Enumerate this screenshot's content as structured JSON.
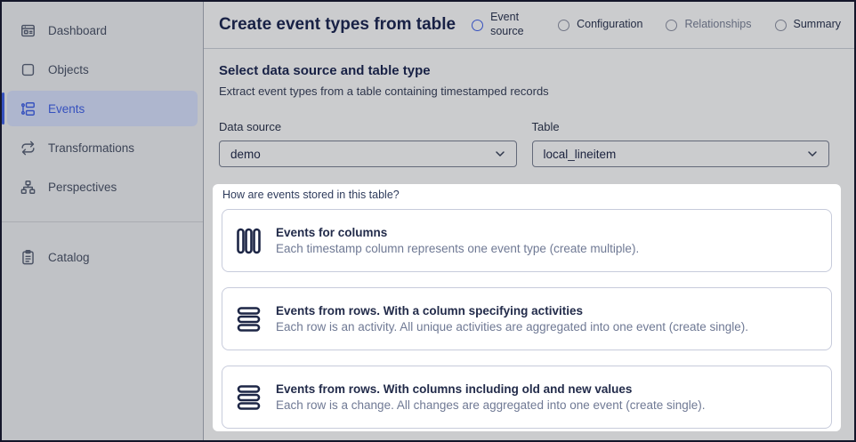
{
  "colors": {
    "accent_blue": "#4263eb",
    "active_item_bg": "#dbe4ff",
    "title_navy": "#1c2752",
    "card_border": "#c7cbdb",
    "muted_text": "#6f7994",
    "dim_overlay": "rgba(10,12,25,0.21)"
  },
  "sidebar": {
    "items": [
      {
        "label": "Dashboard",
        "icon": "dashboard-icon",
        "active": false
      },
      {
        "label": "Objects",
        "icon": "objects-icon",
        "active": false
      },
      {
        "label": "Events",
        "icon": "events-icon",
        "active": true
      },
      {
        "label": "Transformations",
        "icon": "transformations-icon",
        "active": false
      },
      {
        "label": "Perspectives",
        "icon": "perspectives-icon",
        "active": false
      },
      {
        "label": "Catalog",
        "icon": "catalog-icon",
        "active": false
      }
    ]
  },
  "header": {
    "title": "Create event types from table",
    "steps": [
      {
        "label": "Event source",
        "state": "active"
      },
      {
        "label": "Configuration",
        "state": "upcoming"
      },
      {
        "label": "Relationships",
        "state": "upcoming"
      },
      {
        "label": "Summary",
        "state": "upcoming"
      }
    ]
  },
  "main": {
    "section_title": "Select data source and table type",
    "section_description": "Extract event types from a table containing timestamped records",
    "fields": {
      "data_source": {
        "label": "Data source",
        "value": "demo"
      },
      "table": {
        "label": "Table",
        "value": "local_lineitem"
      }
    },
    "storage_question": "How are events stored in this table?",
    "options": [
      {
        "icon": "columns-icon",
        "title": "Events for columns",
        "description": "Each timestamp column represents one event type (create multiple)."
      },
      {
        "icon": "rows-icon",
        "title": "Events from rows. With a column specifying activities",
        "description": "Each row is an activity. All unique activities are aggregated into one event (create single)."
      },
      {
        "icon": "rows-icon",
        "title": "Events from rows. With columns including old and new values",
        "description": "Each row is a change. All changes are aggregated into one event (create single)."
      }
    ]
  }
}
